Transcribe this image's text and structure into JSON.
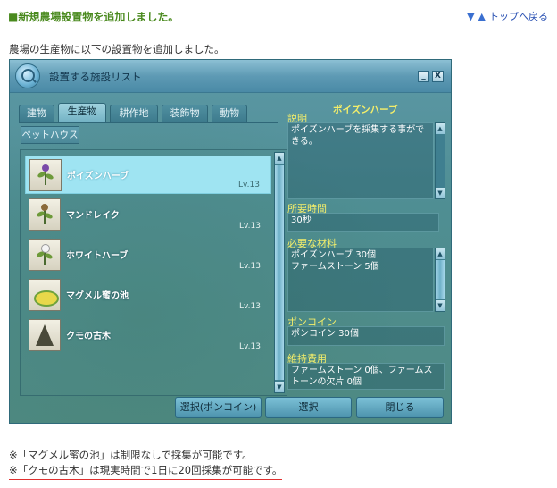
{
  "header": {
    "title": "■新規農場設置物を追加しました。",
    "down_arrow": "▼",
    "up_arrow": "▲",
    "back_link": "トップへ戻る"
  },
  "intro": "農場の生産物に以下の設置物を追加しました。",
  "window": {
    "title": "設置する施設リスト",
    "minimize_label": "_",
    "close_label": "X",
    "tabs": [
      "建物",
      "生産物",
      "耕作地",
      "装飾物",
      "動物"
    ],
    "active_tab": "生産物",
    "subtab": "ペットハウス",
    "items": [
      {
        "name": "ポイズンハーブ",
        "level": "Lv.13",
        "selected": true,
        "icon": "poison-herb-icon"
      },
      {
        "name": "マンドレイク",
        "level": "Lv.13",
        "selected": false,
        "icon": "mandrake-icon"
      },
      {
        "name": "ホワイトハーブ",
        "level": "Lv.13",
        "selected": false,
        "icon": "white-herb-icon"
      },
      {
        "name": "マグメル蜜の池",
        "level": "Lv.13",
        "selected": false,
        "icon": "honey-pond-icon"
      },
      {
        "name": "クモの古木",
        "level": "Lv.13",
        "selected": false,
        "icon": "spider-tree-icon"
      }
    ],
    "detail": {
      "name": "ポイズンハーブ",
      "desc_label": "説明",
      "desc": "ポイズンハーブを採集する事ができる。",
      "time_label": "所要時間",
      "time": "30秒",
      "materials_label": "必要な材料",
      "materials": [
        "ポイズンハーブ 30個",
        "ファームストーン 5個"
      ],
      "poncoin_label": "ポンコイン",
      "poncoin": "ポンコイン 30個",
      "upkeep_label": "維持費用",
      "upkeep": "ファームストーン 0個、ファームストーンの欠片 0個"
    },
    "buttons": {
      "select_poncoin": "選択(ポンコイン)",
      "select": "選択",
      "close": "閉じる"
    }
  },
  "notes": [
    "※「マグメル蜜の池」は制限なしで採集が可能です。",
    "※「クモの古木」は現実時間で1日に20回採集が可能です。"
  ],
  "colors": {
    "title_green": "#4a8a1e",
    "link_blue": "#2b52b3",
    "accent_yellow": "#f4ee6a",
    "selected_row": "#9fe4f2",
    "note_underline": "#e03030"
  }
}
